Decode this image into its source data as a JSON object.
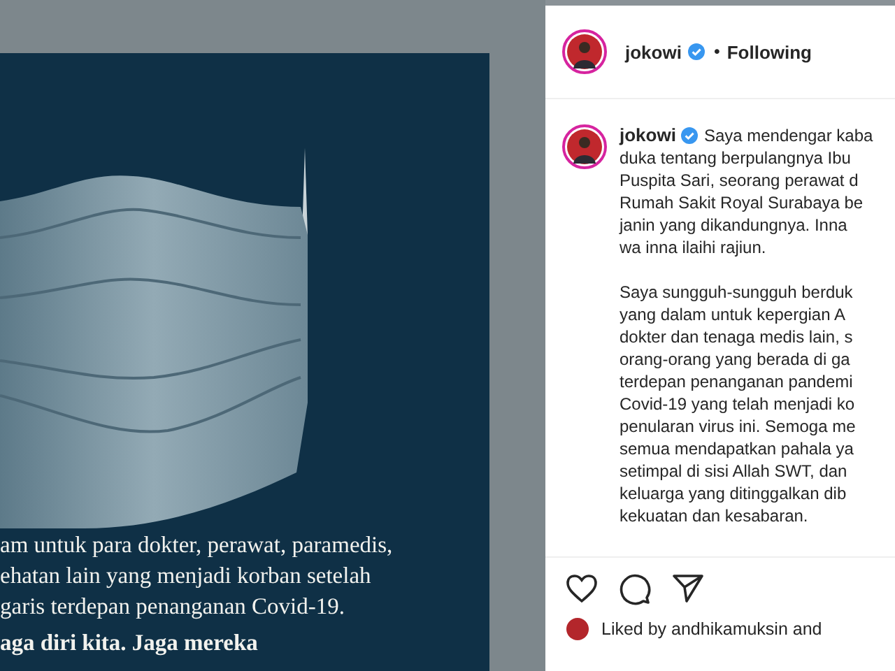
{
  "post_image": {
    "caption_lines": [
      "am untuk para dokter, perawat, paramedis,",
      "ehatan lain yang menjadi korban setelah",
      "garis terdepan penanganan Covid-19."
    ],
    "closing_line": "aga diri kita. Jaga mereka"
  },
  "header": {
    "username": "jokowi",
    "verified": true,
    "separator": "•",
    "follow_label": "Following"
  },
  "caption": {
    "username": "jokowi",
    "verified": true,
    "paragraphs": [
      [
        "Saya mendengar kaba",
        "duka tentang berpulangnya Ibu",
        "Puspita Sari, seorang perawat d",
        "Rumah Sakit Royal Surabaya be",
        "janin yang dikandungnya. Inna",
        "wa inna ilaihi rajiun."
      ],
      [
        "Saya sungguh-sungguh berduk",
        "yang dalam untuk kepergian A",
        "dokter dan tenaga medis lain, s",
        "orang-orang yang berada di ga",
        "terdepan penanganan pandemi",
        "Covid-19 yang telah menjadi ko",
        "penularan virus ini. Semoga me",
        "semua mendapatkan pahala ya",
        "setimpal di sisi Allah SWT, dan",
        "keluarga yang ditinggalkan dib",
        "kekuatan dan kesabaran."
      ]
    ]
  },
  "likes": {
    "text": "Liked by andhikamuksin and"
  }
}
